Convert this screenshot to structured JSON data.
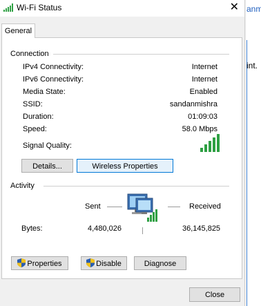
{
  "background_window": {
    "title_fragment": "anmi",
    "text_fragment": "int."
  },
  "window": {
    "title": "Wi-Fi Status",
    "close_glyph": "✕"
  },
  "tabs": [
    {
      "label": "General"
    }
  ],
  "connection": {
    "heading": "Connection",
    "rows": [
      {
        "label": "IPv4 Connectivity:",
        "value": "Internet"
      },
      {
        "label": "IPv6 Connectivity:",
        "value": "Internet"
      },
      {
        "label": "Media State:",
        "value": "Enabled"
      },
      {
        "label": "SSID:",
        "value": "sandanmishra"
      },
      {
        "label": "Duration:",
        "value": "01:09:03"
      },
      {
        "label": "Speed:",
        "value": "58.0 Mbps"
      }
    ],
    "signal_label": "Signal Quality:",
    "signal_bars": 5,
    "signal_level": 5,
    "details_button": "Details...",
    "wireless_button": "Wireless Properties"
  },
  "activity": {
    "heading": "Activity",
    "sent_label": "Sent",
    "received_label": "Received",
    "bytes_label": "Bytes:",
    "sent_bytes": "4,480,026",
    "received_bytes": "36,145,825"
  },
  "actions": {
    "properties": "Properties",
    "disable": "Disable",
    "diagnose": "Diagnose"
  },
  "footer": {
    "close": "Close"
  },
  "colors": {
    "signal_green": "#2ea043",
    "focus_blue": "#0078d7",
    "shield_blue": "#2a5db0",
    "shield_yellow": "#f4c21a"
  }
}
